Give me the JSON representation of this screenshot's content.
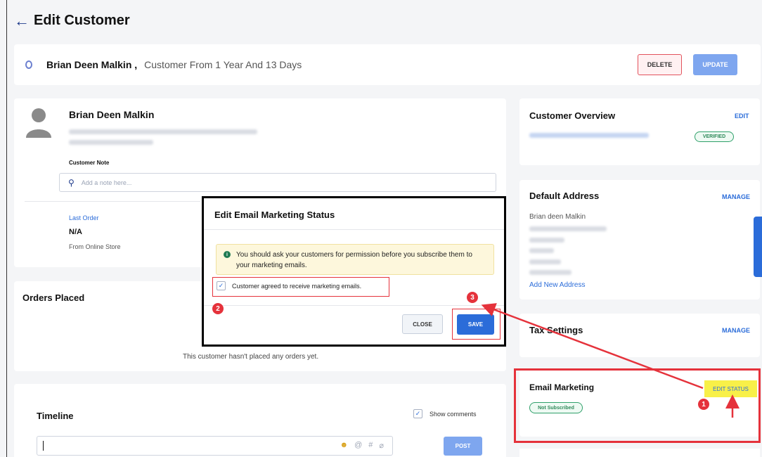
{
  "header": {
    "title": "Edit Customer"
  },
  "topbar": {
    "customer_name": "Brian Deen Malkin ,",
    "customer_since": "Customer From 1 Year And 13 Days",
    "delete_label": "DELETE",
    "update_label": "UPDATE"
  },
  "profile": {
    "name": "Brian Deen Malkin",
    "note_label": "Customer Note",
    "note_placeholder": "Add a note here...",
    "last_order_label": "Last Order",
    "last_order_value": "N/A",
    "last_order_source": "From Online Store"
  },
  "orders": {
    "title": "Orders Placed",
    "empty_text": "This customer hasn't placed any orders yet."
  },
  "timeline": {
    "title": "Timeline",
    "show_comments_label": "Show comments",
    "post_label": "POST"
  },
  "overview": {
    "title": "Customer Overview",
    "edit_label": "EDIT",
    "verified_label": "VERIFIED"
  },
  "address": {
    "title": "Default Address",
    "manage_label": "MANAGE",
    "name_line": "Brian deen Malkin",
    "add_label": "Add New Address"
  },
  "tax": {
    "title": "Tax Settings",
    "manage_label": "MANAGE"
  },
  "email_marketing": {
    "title": "Email Marketing",
    "status": "Not Subscribed",
    "edit_status_label": "EDIT STATUS"
  },
  "modal": {
    "title": "Edit Email Marketing Status",
    "alert_text": "You should ask your customers for permission before you subscribe them to your marketing emails.",
    "agree_label": "Customer agreed to receive marketing emails.",
    "close_label": "CLOSE",
    "save_label": "SAVE"
  },
  "steps": [
    "1",
    "2",
    "3"
  ],
  "colors": {
    "accent": "#2b6cd9",
    "annotation": "#e5323b",
    "highlight": "#f8f048"
  }
}
